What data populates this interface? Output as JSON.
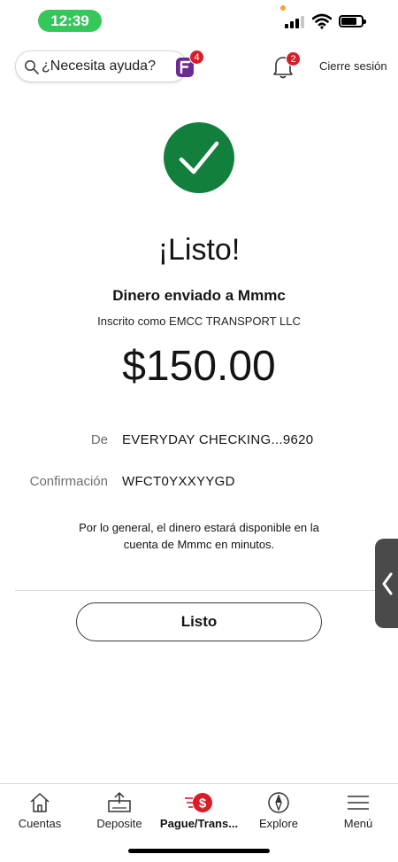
{
  "status_bar": {
    "time": "12:39"
  },
  "header": {
    "search_placeholder": "¿Necesita ayuda?",
    "search_badge": "4",
    "notification_badge": "2",
    "signout_label": "Cierre sesión"
  },
  "confirmation": {
    "title": "¡Listo!",
    "sent_to": "Dinero enviado a Mmmc",
    "enrolled_as": "Inscrito como EMCC TRANSPORT LLC",
    "amount": "$150.00",
    "from_label": "De",
    "from_value": "EVERYDAY CHECKING...9620",
    "confirmation_label": "Confirmación",
    "confirmation_value": "WFCT0YXXYYGD",
    "info": "Por lo general, el dinero estará disponible en la cuenta de Mmmc en minutos.",
    "done_button": "Listo"
  },
  "bottom_nav": {
    "items": [
      {
        "label": "Cuentas",
        "icon": "home-icon"
      },
      {
        "label": "Deposite",
        "icon": "deposit-icon"
      },
      {
        "label": "Pague/Trans...",
        "icon": "pay-transfer-icon",
        "active": true
      },
      {
        "label": "Explore",
        "icon": "compass-icon"
      },
      {
        "label": "Menú",
        "icon": "menu-icon"
      }
    ]
  },
  "colors": {
    "success_green": "#12803c",
    "badge_red": "#d71e28",
    "status_green": "#34c759",
    "side_tab": "#4a4a4a"
  }
}
